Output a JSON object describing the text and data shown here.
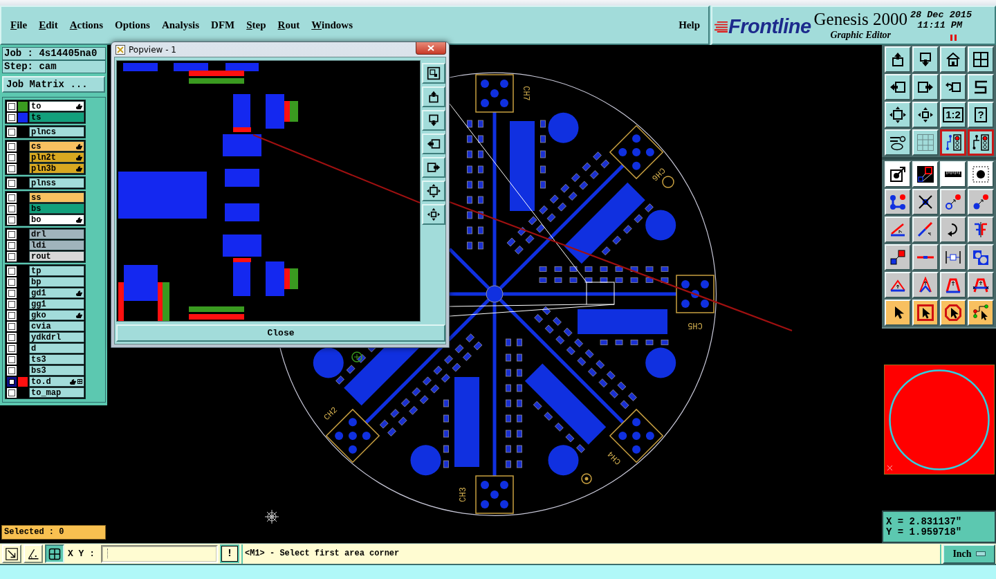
{
  "window": {
    "menu": [
      {
        "label": "File",
        "mnemonic": true
      },
      {
        "label": "Edit",
        "mnemonic": true
      },
      {
        "label": "Actions",
        "mnemonic": true
      },
      {
        "label": "Options",
        "mnemonic": false
      },
      {
        "label": "Analysis",
        "mnemonic": false
      },
      {
        "label": "DFM",
        "mnemonic": false
      },
      {
        "label": "Step",
        "mnemonic": true
      },
      {
        "label": "Rout",
        "mnemonic": true
      },
      {
        "label": "Windows",
        "mnemonic": true
      }
    ],
    "help": "Help"
  },
  "branding": {
    "company": "Frontline",
    "product": "Genesis 2000",
    "module": "Graphic Editor",
    "date": "28 Dec 2015",
    "time": "11:11 PM"
  },
  "job": {
    "job": "Job : 4s14405na0",
    "step": "Step: cam",
    "matrix_button": "Job Matrix ..."
  },
  "layers": {
    "groups": [
      {
        "layers": [
          {
            "name": "to",
            "color": "#ffffff",
            "swatch": {
              "color": "#3a9a20"
            },
            "selected": false,
            "affected": true,
            "grid_mark": false
          },
          {
            "name": "ts",
            "color": "#12a07c",
            "swatch": {
              "color": "#1428f0"
            },
            "selected": false,
            "affected": false,
            "grid_mark": false
          }
        ]
      },
      {
        "layers": [
          {
            "name": "plncs",
            "color": "#a2dcda",
            "selected": false,
            "affected": false,
            "grid_mark": false
          }
        ]
      },
      {
        "layers": [
          {
            "name": "cs",
            "color": "#f8c060",
            "selected": false,
            "affected": true,
            "grid_mark": false
          },
          {
            "name": "pln2t",
            "color": "#d8a820",
            "selected": false,
            "affected": true,
            "grid_mark": false
          },
          {
            "name": "pln3b",
            "color": "#d8a820",
            "selected": false,
            "affected": true,
            "grid_mark": false
          }
        ]
      },
      {
        "layers": [
          {
            "name": "plnss",
            "color": "#a2dcda",
            "selected": false,
            "affected": false,
            "grid_mark": false
          }
        ]
      },
      {
        "layers": [
          {
            "name": "ss",
            "color": "#f8c060",
            "selected": false,
            "affected": false,
            "grid_mark": false
          },
          {
            "name": "bs",
            "color": "#12a07c",
            "selected": false,
            "affected": false,
            "grid_mark": false
          },
          {
            "name": "bo",
            "color": "#ffffff",
            "selected": false,
            "affected": true,
            "grid_mark": false
          }
        ]
      },
      {
        "layers": [
          {
            "name": "drl",
            "color": "#a0b4bc",
            "selected": false,
            "affected": false,
            "grid_mark": false
          },
          {
            "name": "ldi",
            "color": "#a0b4bc",
            "selected": false,
            "affected": false,
            "grid_mark": false
          },
          {
            "name": "rout",
            "color": "#d8d8d8",
            "selected": false,
            "affected": false,
            "grid_mark": false
          }
        ]
      },
      {
        "layers": [
          {
            "name": "tp",
            "color": "#a2dcda",
            "selected": false,
            "affected": false,
            "grid_mark": false
          },
          {
            "name": "bp",
            "color": "#a2dcda",
            "selected": false,
            "affected": false,
            "grid_mark": false
          },
          {
            "name": "gd1",
            "color": "#a2dcda",
            "selected": false,
            "affected": true,
            "grid_mark": false
          },
          {
            "name": "gg1",
            "color": "#a2dcda",
            "selected": false,
            "affected": false,
            "grid_mark": false
          },
          {
            "name": "gko",
            "color": "#a2dcda",
            "selected": false,
            "affected": true,
            "grid_mark": false
          },
          {
            "name": "cvia",
            "color": "#a2dcda",
            "selected": false,
            "affected": false,
            "grid_mark": false
          },
          {
            "name": "ydkdrl",
            "color": "#a2dcda",
            "selected": false,
            "affected": false,
            "grid_mark": false
          },
          {
            "name": "d",
            "color": "#a2dcda",
            "selected": false,
            "affected": false,
            "grid_mark": false
          },
          {
            "name": "ts3",
            "color": "#a2dcda",
            "selected": false,
            "affected": false,
            "grid_mark": false
          },
          {
            "name": "bs3",
            "color": "#a2dcda",
            "selected": false,
            "affected": false,
            "grid_mark": false
          },
          {
            "name": "to.d",
            "color": "#a2dcda",
            "swatch": {
              "color": "#ff1010"
            },
            "selected": true,
            "affected": true,
            "grid_mark": true
          },
          {
            "name": "to_map",
            "color": "#a2dcda",
            "selected": false,
            "affected": false,
            "grid_mark": false
          }
        ]
      }
    ]
  },
  "selected_count": "Selected : 0",
  "board": {
    "labels": [
      "CH7",
      "CH6",
      "CH5",
      "CH4",
      "CH3",
      "CH2"
    ]
  },
  "popview": {
    "title": "Popview - 1",
    "close_button": "Close"
  },
  "tool_palette": {
    "rows": [
      {
        "kind": "view",
        "buttons": [
          {
            "on": false
          },
          {
            "on": false
          },
          {
            "on": false
          },
          {
            "on": false
          }
        ]
      },
      {
        "kind": "view",
        "buttons": [
          {
            "on": false
          },
          {
            "on": false
          },
          {
            "on": false
          },
          {
            "on": false
          }
        ]
      },
      {
        "kind": "view",
        "buttons": [
          {
            "on": false
          },
          {
            "on": false
          },
          {
            "on": false,
            "label": "1:2"
          },
          {
            "on": false,
            "label": "?"
          }
        ]
      },
      {
        "kind": "view",
        "buttons": [
          {
            "on": false
          },
          {
            "on": false
          },
          {
            "on": true
          },
          {
            "on": true
          }
        ]
      },
      {
        "kind": "display",
        "buttons": [
          {
            "on": false
          },
          {
            "on": false
          },
          {
            "on": false
          },
          {
            "on": false
          }
        ]
      },
      {
        "kind": "edit",
        "buttons": [
          {
            "on": false
          },
          {
            "on": false
          },
          {
            "on": false
          },
          {
            "on": false
          }
        ]
      },
      {
        "kind": "edit",
        "buttons": [
          {
            "on": false
          },
          {
            "on": false
          },
          {
            "on": false
          },
          {
            "on": false
          }
        ]
      },
      {
        "kind": "edit",
        "buttons": [
          {
            "on": false
          },
          {
            "on": false
          },
          {
            "on": false
          },
          {
            "on": false
          }
        ]
      },
      {
        "kind": "edit",
        "buttons": [
          {
            "on": false
          },
          {
            "on": false
          },
          {
            "on": false
          },
          {
            "on": false
          }
        ]
      },
      {
        "kind": "select",
        "buttons": [
          {
            "on": false
          },
          {
            "on": false
          },
          {
            "on": false
          },
          {
            "on": false
          }
        ]
      }
    ]
  },
  "coordinates": {
    "x": "X = 2.831137\"",
    "y": "Y = 1.959718\""
  },
  "command_bar": {
    "tools": [
      {
        "on": false
      },
      {
        "on": false
      },
      {
        "on": true
      }
    ],
    "xy_label": "X Y :",
    "alert_button": "!",
    "prompt": "<M1> - Select first area corner",
    "units": "Inch"
  }
}
